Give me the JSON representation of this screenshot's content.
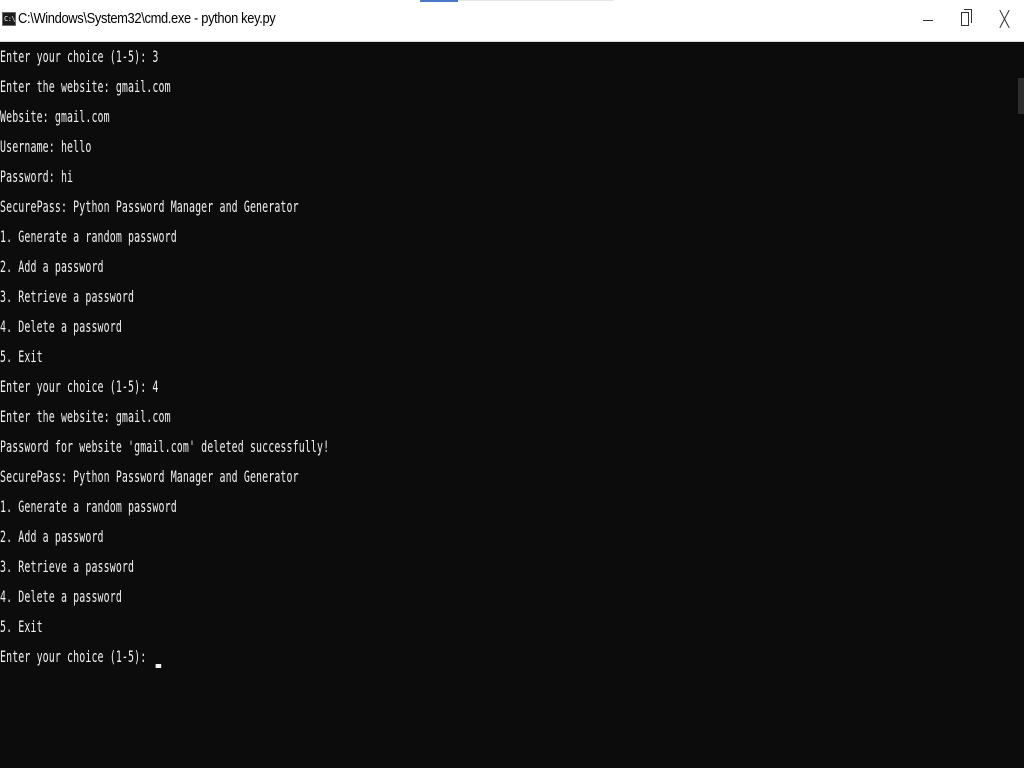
{
  "window": {
    "title": "C:\\Windows\\System32\\cmd.exe - python  key.py",
    "icon": "cmd-icon",
    "icon_label": "C:\\"
  },
  "console": {
    "lines": [
      "Enter your choice (1-5): 3",
      "Enter the website: gmail.com",
      "Website: gmail.com",
      "Username: hello",
      "Password: hi",
      "SecurePass: Python Password Manager and Generator",
      "1. Generate a random password",
      "2. Add a password",
      "3. Retrieve a password",
      "4. Delete a password",
      "5. Exit",
      "Enter your choice (1-5): 4",
      "Enter the website: gmail.com",
      "Password for website 'gmail.com' deleted successfully!",
      "SecurePass: Python Password Manager and Generator",
      "1. Generate a random password",
      "2. Add a password",
      "3. Retrieve a password",
      "4. Delete a password",
      "5. Exit",
      "Enter your choice (1-5): "
    ]
  },
  "colors": {
    "background": "#0c0c0c",
    "text": "#f2f2f2",
    "titlebar": "#ffffff"
  }
}
